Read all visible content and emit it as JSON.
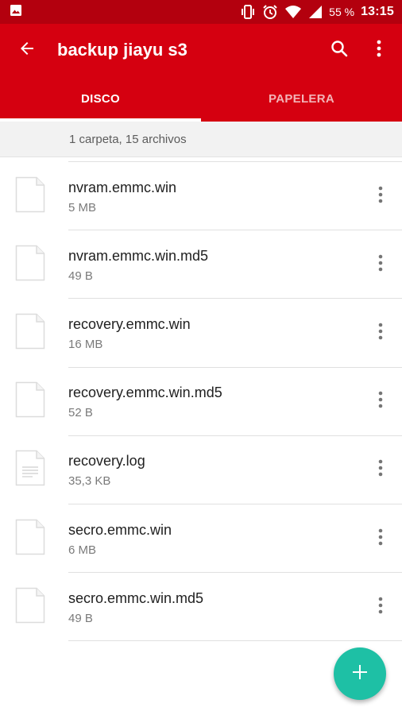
{
  "status_bar": {
    "battery_label": "55 %",
    "time": "13:15",
    "icons": [
      "image-icon",
      "vibrate-icon",
      "alarm-icon",
      "wifi-icon",
      "signal-icon"
    ]
  },
  "app_bar": {
    "title": "backup jiayu s3",
    "icons": [
      "arrow-left-icon",
      "search-icon",
      "more-vert-icon"
    ]
  },
  "tabs": [
    {
      "label": "DISCO",
      "active": true
    },
    {
      "label": "PAPELERA",
      "active": false
    }
  ],
  "summary": "1 carpeta, 15 archivos",
  "files": [
    {
      "name": "nvram.emmc.win",
      "size": "5 MB",
      "icon": "file-icon"
    },
    {
      "name": "nvram.emmc.win.md5",
      "size": "49 B",
      "icon": "file-icon"
    },
    {
      "name": "recovery.emmc.win",
      "size": "16 MB",
      "icon": "file-icon"
    },
    {
      "name": "recovery.emmc.win.md5",
      "size": "52 B",
      "icon": "file-icon"
    },
    {
      "name": "recovery.log",
      "size": "35,3 KB",
      "icon": "text-file-icon"
    },
    {
      "name": "secro.emmc.win",
      "size": "6 MB",
      "icon": "file-icon"
    },
    {
      "name": "secro.emmc.win.md5",
      "size": "49 B",
      "icon": "file-icon"
    }
  ],
  "fab": {
    "icon": "plus-icon"
  },
  "colors": {
    "status_bar": "#b3000e",
    "app_bar": "#d50010",
    "fab": "#1ec0a5"
  }
}
